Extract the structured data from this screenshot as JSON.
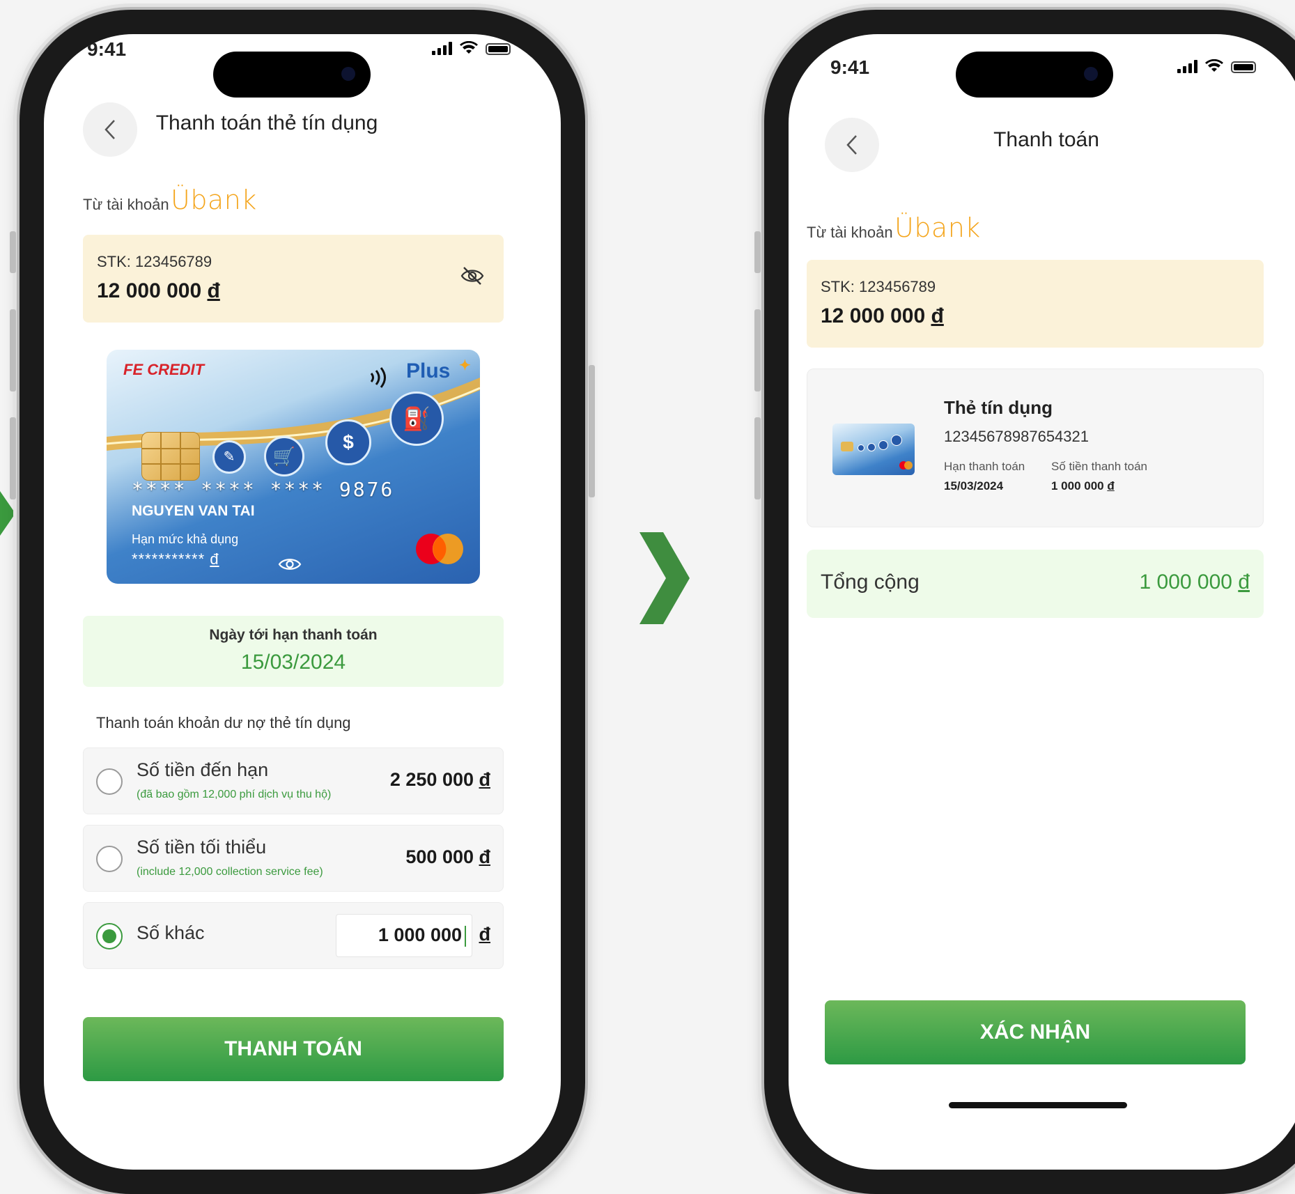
{
  "screen1": {
    "status_time": "9:41",
    "title": "Thanh toán thẻ tín dụng",
    "from_account_label": "Từ tài khoản",
    "bank_logo": "Übank",
    "account": {
      "number": "STK: 123456789",
      "balance": "12 000 000 ",
      "currency": "đ"
    },
    "card": {
      "issuer": "FE CREDIT",
      "tier": "Plus",
      "masked_number": "**** **** **** 9876",
      "holder": "NGUYEN VAN TAI",
      "limit_label": "Hạn mức khả dụng",
      "limit_value": "***********",
      "currency": "đ"
    },
    "due": {
      "label": "Ngày tới hạn thanh toán",
      "date": "15/03/2024"
    },
    "section_label": "Thanh toán khoản dư nợ thẻ tín dụng",
    "options": [
      {
        "label": "Số tiền đến hạn",
        "note": "(đã bao gồm 12,000 phí dịch vụ thu hộ)",
        "amount": "2 250 000 ",
        "currency": "đ",
        "selected": false
      },
      {
        "label": "Số tiền tối thiểu",
        "note": "(include 12,000 collection service fee)",
        "amount": "500 000 ",
        "currency": "đ",
        "selected": false
      },
      {
        "label": "Số khác",
        "amount": "1 000 000",
        "currency": "đ",
        "selected": true
      }
    ],
    "submit_label": "THANH TOÁN"
  },
  "screen2": {
    "status_time": "9:41",
    "title": "Thanh toán",
    "from_account_label": "Từ tài khoản",
    "bank_logo": "Übank",
    "account": {
      "number": "STK: 123456789",
      "balance": "12 000 000 ",
      "currency": "đ"
    },
    "card_summary": {
      "title": "Thẻ tín dụng",
      "number": "12345678987654321",
      "due_label": "Hạn thanh toán",
      "due_value": "15/03/2024",
      "amount_label": "Số tiền thanh toán",
      "amount_value": "1 000 000 ",
      "currency": "đ"
    },
    "total": {
      "label": "Tổng cộng",
      "value": "1 000 000 ",
      "currency": "đ"
    },
    "confirm_label": "XÁC NHẬN"
  },
  "colors": {
    "brand_green": "#3b9a3e",
    "ubank_orange": "#f4a51c",
    "account_bg": "#fbf2d9",
    "due_bg": "#eefbe9"
  },
  "icons": [
    "back-chevron-icon",
    "eye-off-icon",
    "eye-icon",
    "contactless-icon",
    "mastercard-logo",
    "chip-icon",
    "shopping-cart-icon",
    "dollar-phone-icon",
    "fuel-icon",
    "ticket-icon",
    "signal-icon",
    "wifi-icon",
    "battery-icon",
    "next-arrow-icon"
  ]
}
